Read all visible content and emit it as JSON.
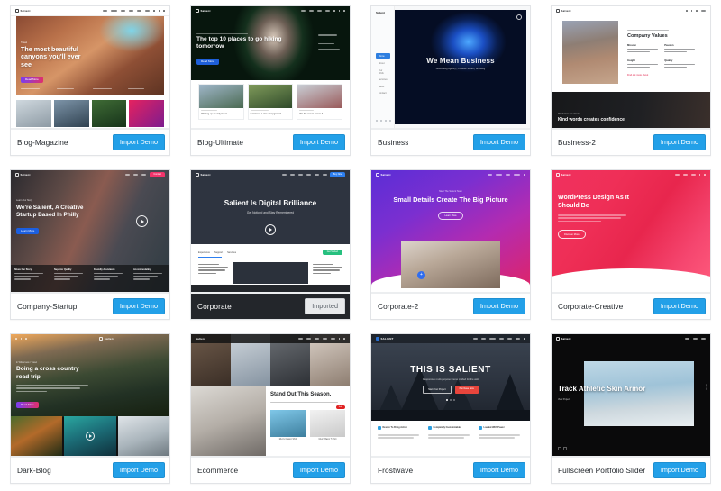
{
  "theme": {
    "accent_button_color": "#23a0e8",
    "imported_button_color": "#e8eaec",
    "card_border_color": "#e2e4e7"
  },
  "labels": {
    "import_demo": "Import Demo",
    "imported": "Imported"
  },
  "demos": [
    {
      "name": "Blog-Magazine",
      "button_label": "Import Demo",
      "state": "available",
      "preview": {
        "brand": "Salient",
        "headline": "The most beautiful canyons you'll ever see",
        "eyebrow": "Travel",
        "cta": "Read More",
        "nav": [
          "Blog",
          "Explore Pages",
          "Team",
          "Shop",
          "Gallery",
          "Contact"
        ]
      }
    },
    {
      "name": "Blog-Ultimate",
      "button_label": "Import Demo",
      "state": "available",
      "preview": {
        "brand": "Salient",
        "headline": "The top 10 places to go hiking tomorrow",
        "cta": "Read More",
        "card_titles": [
          "Walking up at early hours",
          "Get home a nice campground",
          "We the sweet corner 4"
        ]
      }
    },
    {
      "name": "Business",
      "button_label": "Import Demo",
      "state": "available",
      "preview": {
        "brand": "Salient",
        "headline": "We Mean Business",
        "subhead": "Advertising Agency  |  Creative Studio  |  Branding",
        "sidebar_items": [
          "Home",
          "About",
          "Our Work",
          "Services",
          "News",
          "Contact"
        ]
      }
    },
    {
      "name": "Business-2",
      "button_label": "Import Demo",
      "state": "available",
      "preview": {
        "brand": "Salient",
        "headline": "Company Values",
        "eyebrow": "About Our Studio",
        "columns": [
          "Mission",
          "Passion",
          "Insight",
          "Quality"
        ],
        "link": "Find out more about",
        "footer_headline": "Kind words creates confidence.",
        "footer_eyebrow": "Words from our clients"
      }
    },
    {
      "name": "Company-Startup",
      "button_label": "Import Demo",
      "state": "available",
      "preview": {
        "brand": "Salient",
        "eyebrow": "Learn Our Story",
        "headline": "We're Salient, A Creative Startup Based In Philly",
        "cta": "Learn More",
        "nav_cta": "Contact",
        "nav": [
          "Work",
          "About",
          "Blog",
          "Contact"
        ],
        "columns": [
          "Share Our Story",
          "Superior Quality",
          "Friendly Assistance",
          "Accommodating"
        ]
      }
    },
    {
      "name": "Corporate",
      "button_label": "Imported",
      "state": "imported",
      "preview": {
        "brand": "Salient",
        "headline": "Salient Is Digital Brilliance",
        "subhead": "Get Noticed and Stay Remembered",
        "nav": [
          "Home",
          "About",
          "Pricing",
          "Blog",
          "Portfolio",
          "Contact",
          "Shop"
        ],
        "nav_cta": "Buy Now",
        "tabs": [
          "Experience",
          "Support",
          "Services"
        ],
        "badge": "Get Started"
      }
    },
    {
      "name": "Corporate-2",
      "button_label": "Import Demo",
      "state": "available",
      "preview": {
        "brand": "Salient",
        "eyebrow": "Meet The Salient Team",
        "headline": "Small Details Create The Big Picture",
        "cta": "Learn More",
        "nav": [
          "Home",
          "Services",
          "Work",
          "Contact Us"
        ]
      }
    },
    {
      "name": "Corporate-Creative",
      "button_label": "Import Demo",
      "state": "available",
      "preview": {
        "brand": "Salient",
        "headline": "WordPress Design As It Should Be",
        "cta": "Discover More",
        "nav": [
          "Pages",
          "Work",
          "Contact"
        ]
      }
    },
    {
      "name": "Dark-Blog",
      "button_label": "Import Demo",
      "state": "available",
      "preview": {
        "brand": "Salient",
        "eyebrow": "In Wilderness / Travel",
        "headline": "Doing a cross country road trip",
        "cta": "Read More"
      }
    },
    {
      "name": "Ecommerce",
      "button_label": "Import Demo",
      "state": "available",
      "preview": {
        "brand": "Salient",
        "headline": "Stand Out This Season.",
        "nav": [
          "Shop",
          "New In",
          "Lookbook",
          "Journal",
          "About",
          "Contact"
        ],
        "product_labels": [
          "Men's Classic Shirt",
          "Men's Basic T-Shirt"
        ],
        "sale_badge": "Sale"
      }
    },
    {
      "name": "Frostwave",
      "button_label": "Import Demo",
      "state": "available",
      "preview": {
        "brand": "SALIENT",
        "headline": "THIS IS SALIENT",
        "subhead": "Responsive multi-purpose theme crafted for the web",
        "buttons": [
          "Start Your Project",
          "Purchase Now"
        ],
        "nav": [
          "Home",
          "Pages",
          "Portfolio",
          "Features",
          "Blog",
          "Shop"
        ],
        "features": [
          "Design To Bring Action",
          "Completely Customizable",
          "Loaded With Power"
        ]
      }
    },
    {
      "name": "Fullscreen Portfolio Slider",
      "button_label": "Import Demo",
      "state": "available",
      "preview": {
        "brand": "Salient",
        "headline": "Track Athletic Skin Armor",
        "caption": "View Project",
        "nav": [
          "Work",
          "About",
          "Contact"
        ]
      }
    }
  ]
}
